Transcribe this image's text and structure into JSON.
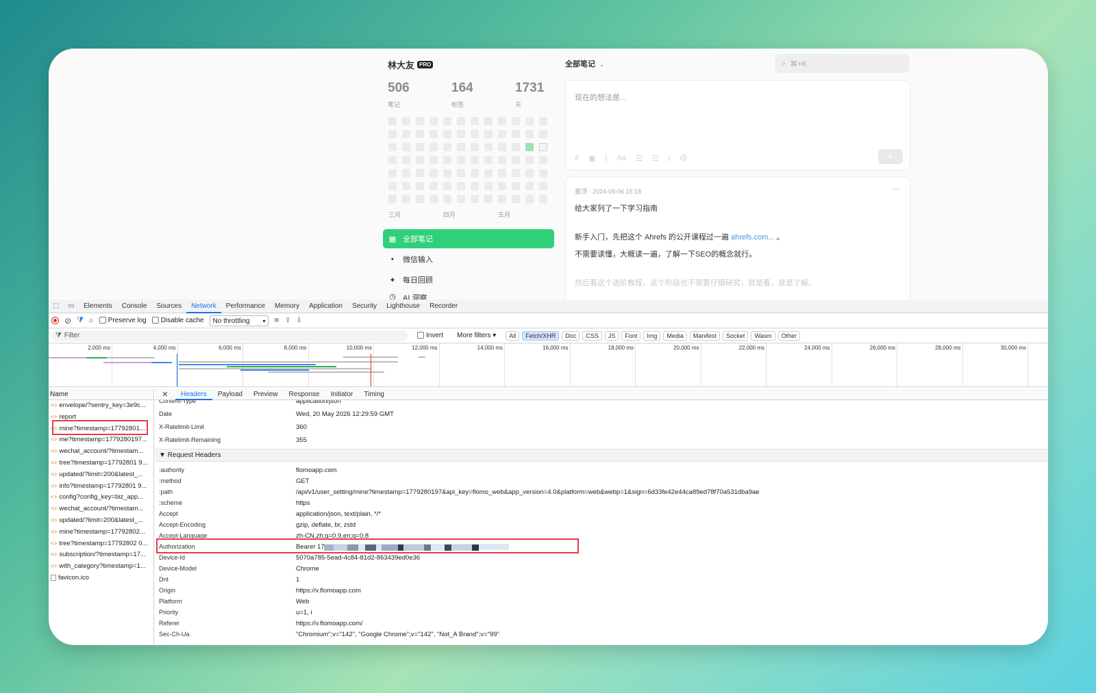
{
  "app": {
    "username": "林大友",
    "badge": "PRO",
    "stats": [
      {
        "value": "506",
        "label": "笔记"
      },
      {
        "value": "164",
        "label": "标签"
      },
      {
        "value": "1731",
        "label": "天"
      }
    ],
    "months": [
      "三月",
      "四月",
      "五月"
    ],
    "menu": [
      {
        "label": "全部笔记",
        "icon": "grid-icon"
      },
      {
        "label": "微信输入",
        "icon": "chat-icon"
      },
      {
        "label": "每日回顾",
        "icon": "sparkle-icon"
      },
      {
        "label": "AI 洞察",
        "icon": "clock-icon"
      }
    ],
    "feed_selector": "全部笔记",
    "search_placeholder": "⌘+K",
    "editor_placeholder": "现在的想法是...",
    "note": {
      "meta": "置顶 · 2024-09-06 15:18",
      "line1": "给大家列了一下学习指南",
      "line2_prefix": "新手入门，先把这个 Ahrefs 的公开课程过一遍 ",
      "line2_link": "ahrefs.com...",
      "line2_suffix": " 。",
      "line3": "不需要读懂，大概读一遍，了解一下SEO的概念就行。",
      "line4": "然后看这个进阶教程，这个阶段也不需要仔细研究，就是看，就是了解。"
    }
  },
  "devtools": {
    "tabs": [
      "Elements",
      "Console",
      "Sources",
      "Network",
      "Performance",
      "Memory",
      "Application",
      "Security",
      "Lighthouse",
      "Recorder"
    ],
    "selected_tab": "Network",
    "toolbar": {
      "preserve_log": "Preserve log",
      "disable_cache": "Disable cache",
      "throttling": "No throttling"
    },
    "filter": {
      "placeholder": "Filter",
      "invert": "Invert",
      "more_filters": "More filters",
      "chips": [
        "All",
        "Fetch/XHR",
        "Doc",
        "CSS",
        "JS",
        "Font",
        "Img",
        "Media",
        "Manifest",
        "Socket",
        "Wasm",
        "Other"
      ],
      "selected_chip": "Fetch/XHR"
    },
    "timeline_ticks": [
      "2,000 ms",
      "4,000 ms",
      "6,000 ms",
      "8,000 ms",
      "10,000 ms",
      "12,000 ms",
      "14,000 ms",
      "16,000 ms",
      "18,000 ms",
      "20,000 ms",
      "22,000 ms",
      "24,000 ms",
      "26,000 ms",
      "28,000 ms",
      "30,000 ms"
    ],
    "name_header": "Name",
    "requests": [
      {
        "name": "envelope/?sentry_key=3e9c...",
        "type": "xhr"
      },
      {
        "name": "report",
        "type": "xhr"
      },
      {
        "name": "mine?timestamp=17792801...",
        "type": "xhr"
      },
      {
        "name": "me?timestamp=1779280197...",
        "type": "xhr"
      },
      {
        "name": "wechat_account/?timestam...",
        "type": "xhr"
      },
      {
        "name": "tree?timestamp=17792801 9...",
        "type": "xhr"
      },
      {
        "name": "updated/?limit=200&latest_...",
        "type": "xhr"
      },
      {
        "name": "info?timestamp=17792801 9...",
        "type": "xhr"
      },
      {
        "name": "config?config_key=biz_app...",
        "type": "xhr"
      },
      {
        "name": "wechat_account/?timestam...",
        "type": "xhr"
      },
      {
        "name": "updated/?limit=200&latest_...",
        "type": "xhr"
      },
      {
        "name": "mine?timestamp=17792802...",
        "type": "xhr"
      },
      {
        "name": "tree?timestamp=17792802 0...",
        "type": "xhr"
      },
      {
        "name": "subscription/?timestamp=17...",
        "type": "xhr"
      },
      {
        "name": "with_category?timestamp=1...",
        "type": "xhr"
      },
      {
        "name": "favicon.ico",
        "type": "file"
      }
    ],
    "detail_tabs": [
      "Headers",
      "Payload",
      "Preview",
      "Response",
      "Initiator",
      "Timing"
    ],
    "selected_detail_tab": "Headers",
    "response_headers": [
      {
        "k": "Content-Type",
        "v": "application/json"
      },
      {
        "k": "Date",
        "v": "Wed, 20 May 2026 12:29:59 GMT"
      },
      {
        "k": "X-Ratelimit-Limit",
        "v": "360"
      },
      {
        "k": "X-Ratelimit-Remaining",
        "v": "355"
      }
    ],
    "request_headers_title": "▼ Request Headers",
    "request_headers": [
      {
        "k": ":authority",
        "v": "flomoapp.com"
      },
      {
        "k": ":method",
        "v": "GET"
      },
      {
        "k": ":path",
        "v": "/api/v1/user_setting/mine?timestamp=1779280197&api_key=flomo_web&app_version=4.0&platform=web&webp=1&sign=6d33fe42e44ca89ed78f70a531dba9ae"
      },
      {
        "k": ":scheme",
        "v": "https"
      },
      {
        "k": "Accept",
        "v": "application/json, text/plain, */*"
      },
      {
        "k": "Accept-Encoding",
        "v": "gzip, deflate, br, zstd"
      },
      {
        "k": "Accept-Language",
        "v": "zh-CN,zh;q=0.9,en;q=0.8"
      },
      {
        "k": "Authorization",
        "v": "Bearer 174"
      },
      {
        "k": "Device-Id",
        "v": "5070a785-5ead-4c84-81d2-863439ed0e36"
      },
      {
        "k": "Device-Model",
        "v": "Chrome"
      },
      {
        "k": "Dnt",
        "v": "1"
      },
      {
        "k": "Origin",
        "v": "https://v.flomoapp.com"
      },
      {
        "k": "Platform",
        "v": "Web"
      },
      {
        "k": "Priority",
        "v": "u=1, i"
      },
      {
        "k": "Referer",
        "v": "https://v.flomoapp.com/"
      },
      {
        "k": "Sec-Ch-Ua",
        "v": "\"Chromium\";v=\"142\", \"Google Chrome\";v=\"142\", \"Not_A Brand\";v=\"99\""
      }
    ]
  }
}
